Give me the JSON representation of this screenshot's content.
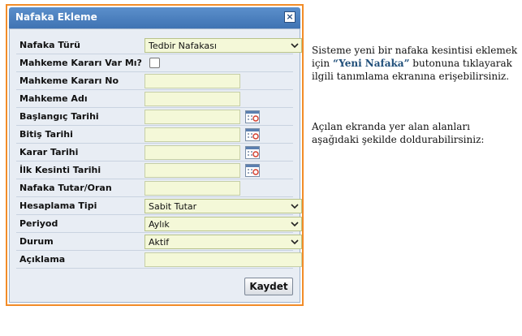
{
  "dialog": {
    "title": "Nafaka Ekleme",
    "close_glyph": "×",
    "submit_label": "Kaydet",
    "fields": {
      "nafaka_turu": {
        "label": "Nafaka Türü",
        "value": "Tedbir Nafakası"
      },
      "mahkeme_karari_var": {
        "label": "Mahkeme Kararı Var Mı?",
        "checked": false
      },
      "mahkeme_karari_no": {
        "label": "Mahkeme Kararı No",
        "value": ""
      },
      "mahkeme_adi": {
        "label": "Mahkeme Adı",
        "value": ""
      },
      "baslangic_tarihi": {
        "label": "Başlangıç Tarihi",
        "value": ""
      },
      "bitis_tarihi": {
        "label": "Bitiş Tarihi",
        "value": ""
      },
      "karar_tarihi": {
        "label": "Karar Tarihi",
        "value": ""
      },
      "ilk_kesinti_tarihi": {
        "label": "İlk Kesinti Tarihi",
        "value": ""
      },
      "nafaka_tutar_oran": {
        "label": "Nafaka Tutar/Oran",
        "value": ""
      },
      "hesaplama_tipi": {
        "label": "Hesaplama Tipi",
        "value": "Sabit Tutar"
      },
      "periyod": {
        "label": "Periyod",
        "value": "Aylık"
      },
      "durum": {
        "label": "Durum",
        "value": "Aktif"
      },
      "aciklama": {
        "label": "Açıklama",
        "value": ""
      }
    }
  },
  "instructions": {
    "p1_before": "Sisteme yeni bir nafaka kesintisi eklemek için ",
    "p1_highlight": "“Yeni Nafaka”",
    "p1_after": " butonuna tıklayarak ilgili tanımlama ekranına erişebilirsiniz.",
    "p2": "Açılan ekranda yer alan alanları aşağıdaki şekilde doldurabilirsiniz:"
  },
  "icons": {
    "dropdown": "chevron-down-icon",
    "calendar": "calendar-icon",
    "close": "close-icon"
  },
  "colors": {
    "frame_border": "#f28c28",
    "titlebar": "#4a7fc1",
    "field_bg": "#f4f8d8",
    "highlight_text": "#1f4e79"
  }
}
